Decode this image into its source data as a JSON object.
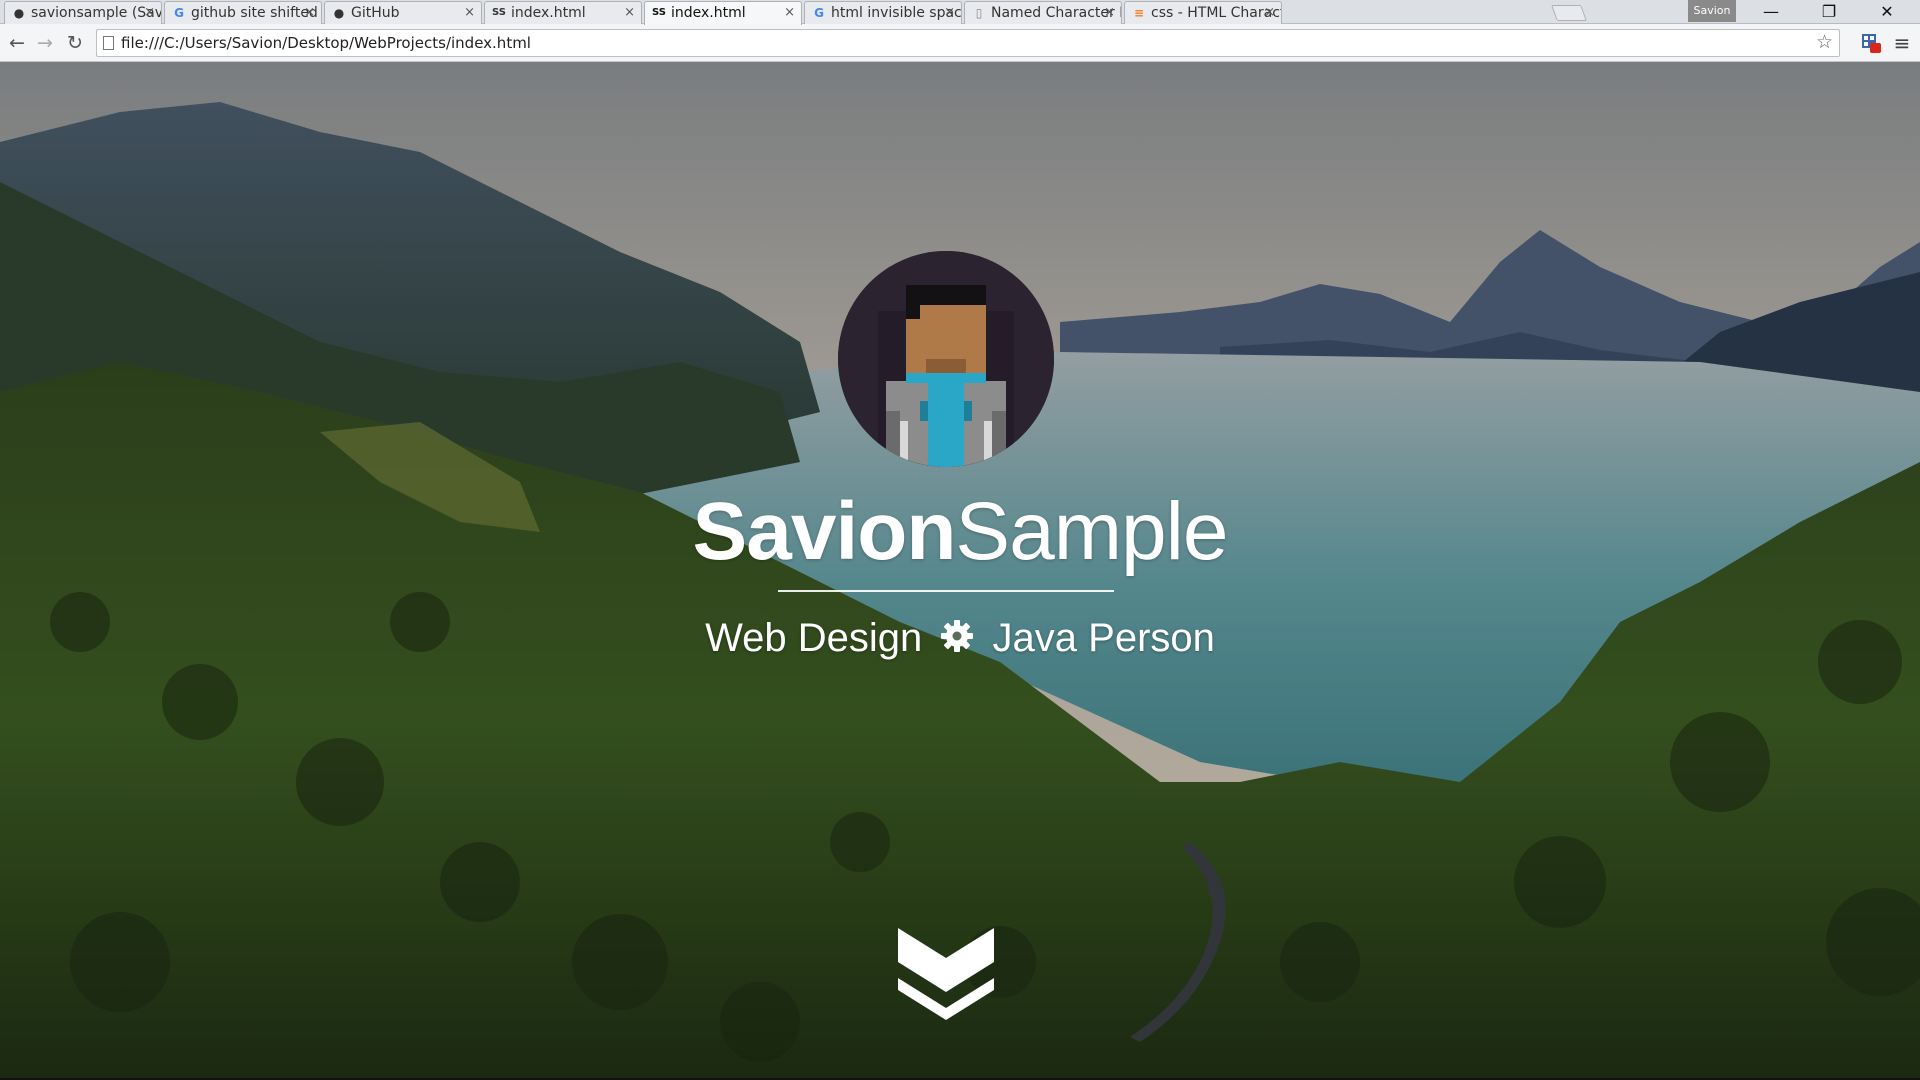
{
  "browser": {
    "tabs": [
      {
        "title": "savionsample (Savior",
        "icon": "github-icon",
        "active": false
      },
      {
        "title": "github site shifted to",
        "icon": "google-icon",
        "active": false
      },
      {
        "title": "GitHub",
        "icon": "github-icon",
        "active": false
      },
      {
        "title": "index.html",
        "icon": "ss-logo-icon",
        "active": false
      },
      {
        "title": "index.html",
        "icon": "ss-logo-icon",
        "active": true
      },
      {
        "title": "html invisible space -",
        "icon": "google-icon",
        "active": false
      },
      {
        "title": "Named Character Ent",
        "icon": "document-icon",
        "active": false
      },
      {
        "title": "css - HTML Characte",
        "icon": "stackoverflow-icon",
        "active": false
      }
    ],
    "tab_close_glyph": "×",
    "profile_name": "Savion",
    "window_controls": {
      "minimize": "—",
      "restore": "❐",
      "close": "✕"
    },
    "nav": {
      "back": "←",
      "forward": "→",
      "reload": "↻"
    },
    "url": "file:///C:/Users/Savion/Desktop/WebProjects/index.html",
    "bookmark_glyph": "☆",
    "menu_glyph": "≡"
  },
  "hero": {
    "title_bold": "Savion",
    "title_light": "Sample",
    "tagline_left": "Web Design",
    "tagline_right": "Java Person"
  },
  "colors": {
    "text": "#ffffff",
    "avatar_bg": "#2b2330",
    "avatar_skin": "#b07a48",
    "avatar_hair": "#141114",
    "avatar_shirt": "#2aa6c6",
    "avatar_jacket": "#8c8c8c"
  }
}
